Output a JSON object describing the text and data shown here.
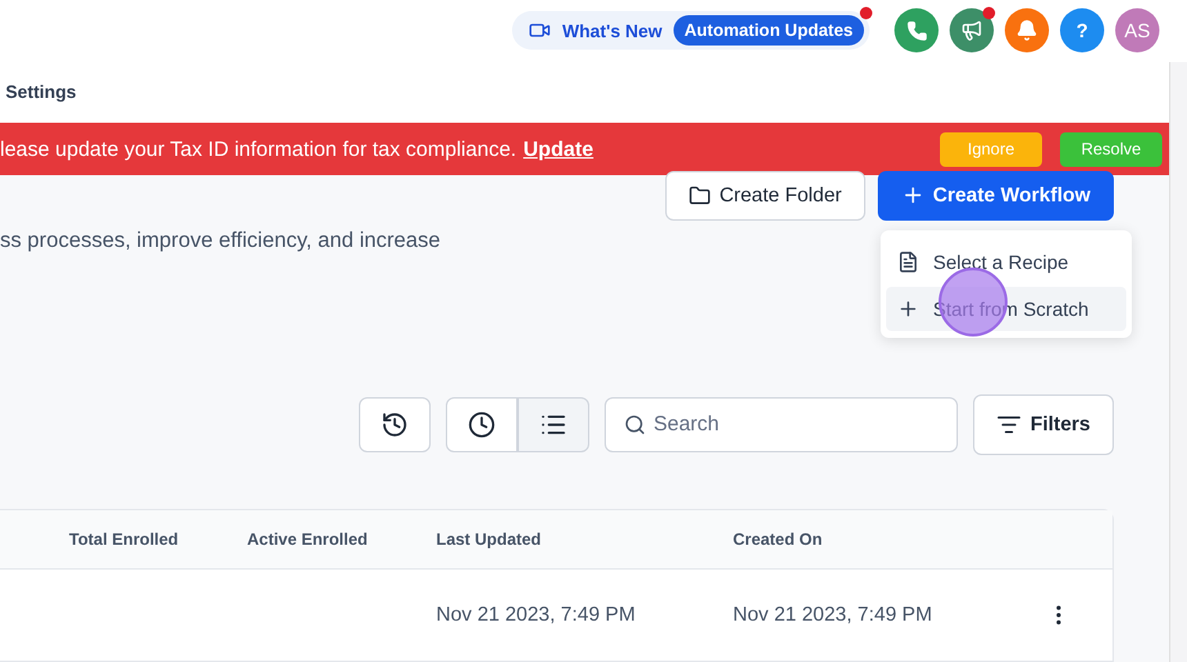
{
  "header": {
    "whats_new": "What's New",
    "updates_badge": "Automation Updates",
    "updates_unread": true,
    "announcements_unread": true,
    "help": "?",
    "avatar": "AS"
  },
  "nav": {
    "title": "Settings"
  },
  "banner": {
    "message": "lease update your Tax ID information for tax compliance.",
    "link": "Update",
    "buttons": [
      {
        "label": "Ignore",
        "kind": "warn"
      },
      {
        "label": "Resolve",
        "kind": "ok"
      }
    ]
  },
  "actions": {
    "create_folder": "Create Folder",
    "create_workflow": "Create Workflow",
    "menu": [
      {
        "label": "Select a Recipe",
        "kind": "recipe",
        "selected": false
      },
      {
        "label": "Start from Scratch",
        "kind": "plus",
        "selected": true
      }
    ]
  },
  "description": "ss processes, improve efficiency, and increase",
  "toolbar": {
    "views": [
      {
        "kind": "clock",
        "selected": false
      },
      {
        "kind": "list",
        "selected": true
      }
    ],
    "search": {
      "placeholder": "Search"
    },
    "filters": "Filters"
  },
  "table": {
    "columns": [
      "Total Enrolled",
      "Active Enrolled",
      "Last Updated",
      "Created On"
    ],
    "rows": [
      {
        "cells": [
          "",
          "",
          "Nov 21 2023, 7:49 PM",
          "Nov 21 2023, 7:49 PM"
        ]
      }
    ]
  }
}
